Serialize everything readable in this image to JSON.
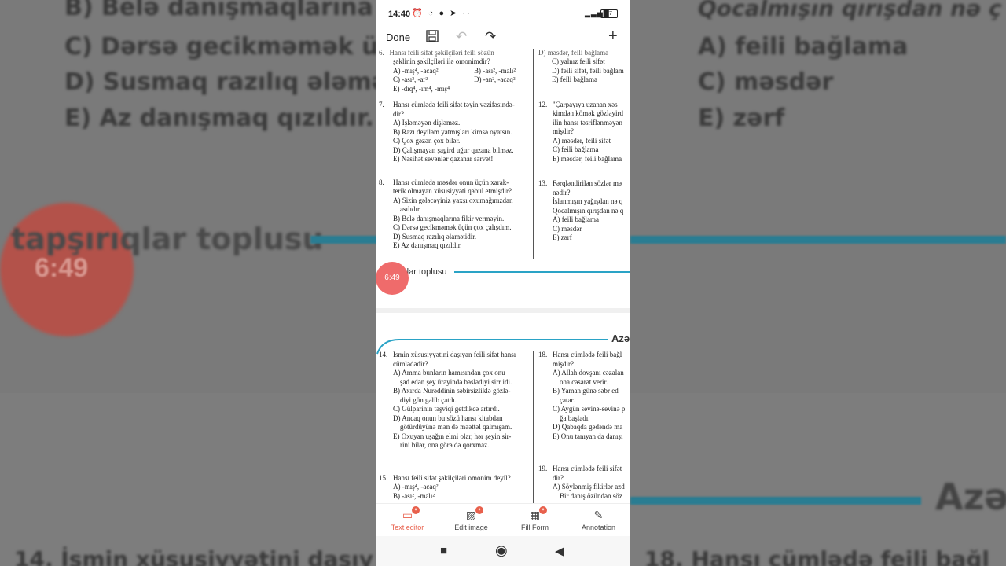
{
  "background": {
    "lines": [
      "B) Belə danışmaqlarına f",
      "C) Dərsə gecikməmək üç",
      "D) Susmaq razılıq ələmət",
      "E) Az danışmaq qızıldır."
    ],
    "right_lines": [
      "Qocalmışın qırışdan nə ç",
      "A) feili bağlama",
      "C) məsdər",
      "E) zərf"
    ],
    "section_label": "tapşırıqlar toplusu",
    "timer": "6:49",
    "bottom_left": "14.  İsmin xüsusiyyətini daşıy",
    "bottom_right": "18.  Hansı cümlədə feili bağl",
    "aze": "Azə"
  },
  "status": {
    "time": "14:40",
    "battery": "77"
  },
  "toolbar": {
    "done": "Done"
  },
  "doc": {
    "top_left": {
      "q6_tail": "şəklinin şəkilçiləri ilə omonimdir?",
      "q6_a": "A) -mış⁴, -acaq²",
      "q6_b": "B) -ası², -malı²",
      "q6_c": "C) -ası², -ar²",
      "q6_d": "D) -an², -acaq²",
      "q6_e": "E) -dıq⁴, -ım⁴, -mış⁴",
      "q7": "Hansı cümlədə feili sifət təyin vəzifəsində-\ndir?\nA) İşləməyən dişləməz.\nB) Razı deyiləm yatmışları kimsə oyatsın.\nC) Çox gəzən çox bilər.\nD) Çalışmayan şagird uğur qazana bilməz.\nE) Nəsihət sevənlər qazanar sərvət!",
      "q8": "Hansı cümlədə məsdər onun üçün xarak-\nterik olmayan xüsusiyyəti qəbul etmişdir?\nA) Sizin gələcəyiniz yaxşı oxumağınızdan\n    asılıdır.\nB) Belə danışmaqlarına fikir verməyin.\nC) Dərsə gecikməmək üçün çox çalışdım.\nD) Susmaq razılıq əlamətidir.\nE) Az danışmaq qızıldır."
    },
    "top_right": {
      "q11_tail": "C) yalnız feili sifət\nD) feili sifət, feili bağlam\nE) feili bağlama",
      "q12": "\"Çarpayıya uzanan xəs\nkimdən kömək gözləyird\nilin hansı təsriflənməyən\nmişdir?\nA) məsdər, feili sifət\nC) feili bağlama\nE) məsdər, feili bağlama",
      "q13": "Fərqləndirilən sözlər mə\nnədir?\nİslanmışın yağışdan nə q\nQocalmışın qırışdan nə q\nA) feili bağlama\nC) məsdər\nE) zərf"
    },
    "section_label": "tapşırıqlar toplusu",
    "timer": "6:49",
    "aze": "Azə",
    "bottom_left": {
      "q14": "İsmin xüsusiyyətini daşıyan feili sifət hansı\ncümlədədir?\nA) Amma bunların hamısından çox onu\n    şad edən şey ürəyində bəslədiyi sirr idi.\nB) Axırda Nurəddinin səbirsizliklə gözlə-\n    diyi gün gəlib çatdı.\nC) Gülparinin təşviqi getdikcə artırdı.\nD) Ancaq onun bu sözü hansı kitabdan\n    götürdüyünə mən də məəttəl qalmışam.\nE) Oxuyan uşağın elmi olar, hər şeyin sir-\n    rini bilər, ona görə də qorxmaz.",
      "q15": "Hansı feili sifət şəkilçiləri omonim deyil?\nA) -mış⁴, -acaq²\nB) -ası², -malı²"
    },
    "bottom_right": {
      "q18": "Hansı cümlədə feili bağl\nmişdir?\nA) Allah dovşanı cəzalan\n    ona cəsarət verir.\nB) Yaman günə səbr ed\n    çatar.\nC) Aygün sevinə-sevinə p\n    ğa başladı.\nD) Qabaqda gedəndə ma\nE) Onu tanıyan da danışı",
      "q19": "Hansı cümlədə feili sifət\ndir?\nA) Söylənmiş fikirlər azd\n    Bir danış özündən söz"
    }
  },
  "tabs": [
    {
      "label": "Text editor",
      "icon": "text-editor-icon"
    },
    {
      "label": "Edit image",
      "icon": "edit-image-icon"
    },
    {
      "label": "Fill Form",
      "icon": "fill-form-icon"
    },
    {
      "label": "Annotation",
      "icon": "annotation-icon"
    }
  ],
  "colors": {
    "accent": "#e8604c",
    "teal": "#2aa3c6",
    "record": "#ef6b6b"
  }
}
